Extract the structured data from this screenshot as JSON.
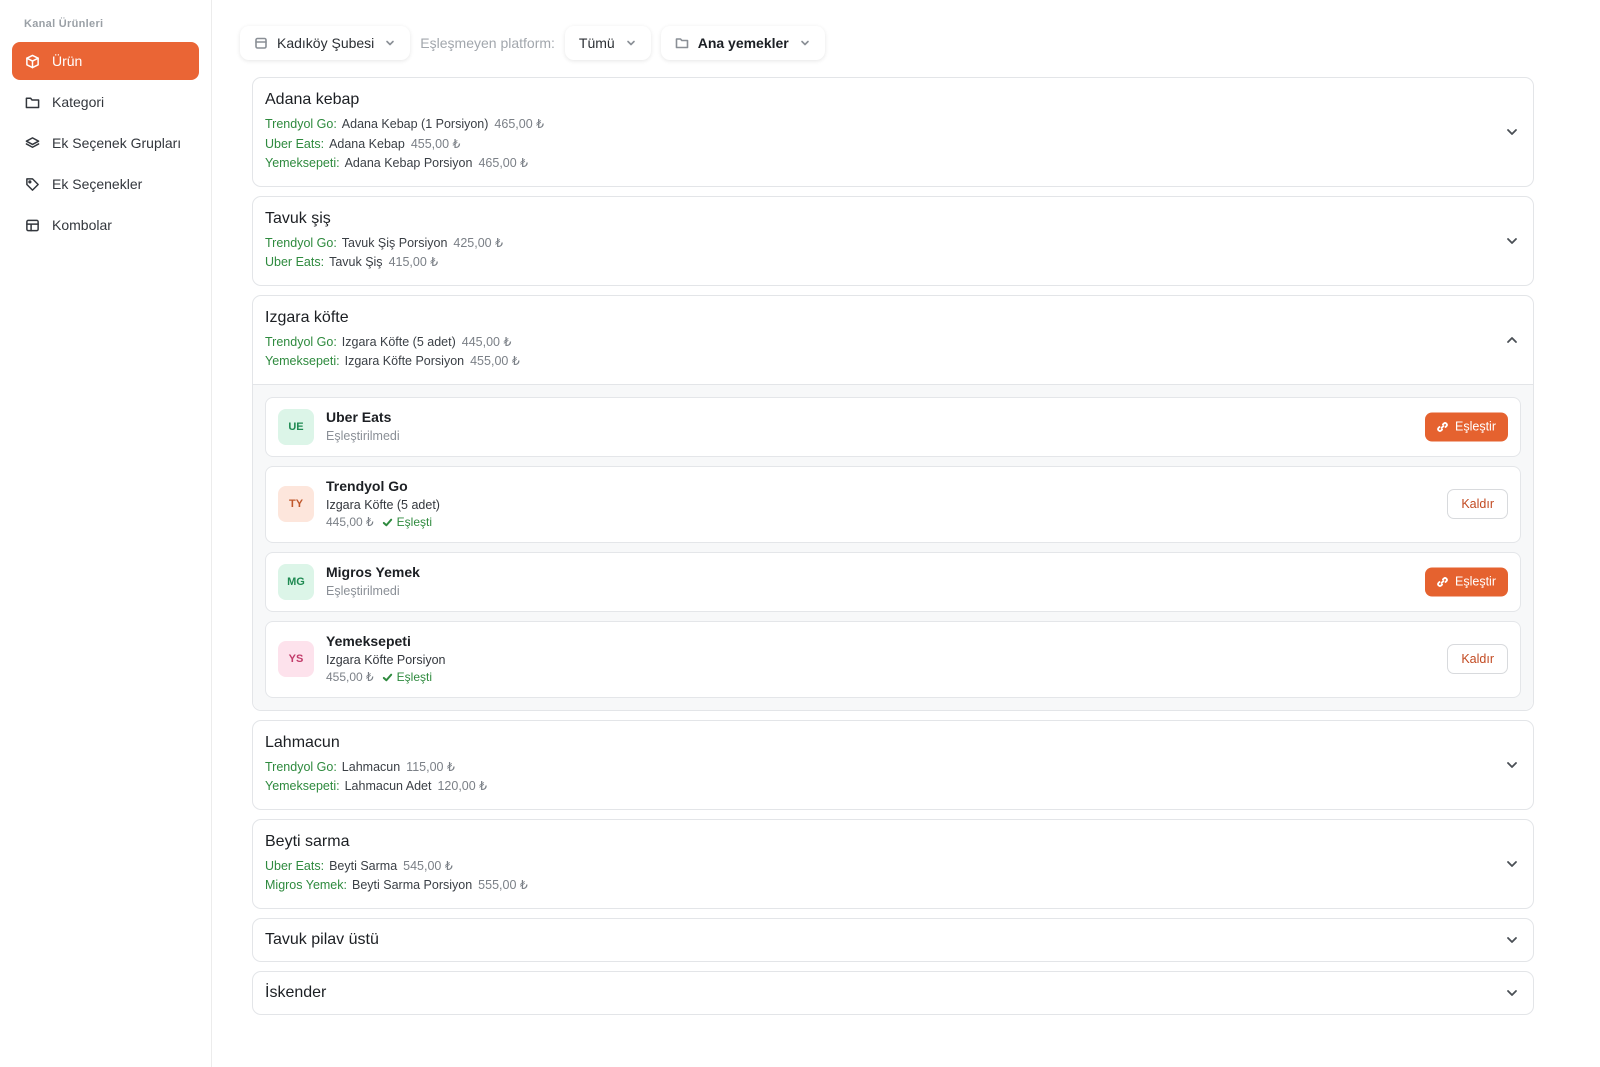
{
  "sidebar": {
    "heading": "Kanal Ürünleri",
    "items": [
      {
        "label": "Ürün",
        "icon": "box-icon",
        "active": true
      },
      {
        "label": "Kategori",
        "icon": "folder-icon"
      },
      {
        "label": "Ek Seçenek Grupları",
        "icon": "layers-icon"
      },
      {
        "label": "Ek Seçenekler",
        "icon": "tag-icon"
      },
      {
        "label": "Kombolar",
        "icon": "table-icon"
      }
    ]
  },
  "filters": {
    "branch": "Kadıköy Şubesi",
    "unmatched_label": "Eşleşmeyen platform:",
    "platform": "Tümü",
    "category": "Ana yemekler"
  },
  "products": [
    {
      "name": "Adana kebap",
      "channels": [
        {
          "platform": "Trendyol Go:",
          "product": "Adana Kebap (1 Porsiyon)",
          "price": "465,00 ₺"
        },
        {
          "platform": "Uber Eats:",
          "product": "Adana Kebap",
          "price": "455,00 ₺"
        },
        {
          "platform": "Yemeksepeti:",
          "product": "Adana Kebap Porsiyon",
          "price": "465,00 ₺"
        }
      ]
    },
    {
      "name": "Tavuk şiş",
      "channels": [
        {
          "platform": "Trendyol Go:",
          "product": "Tavuk Şiş Porsiyon",
          "price": "425,00 ₺"
        },
        {
          "platform": "Uber Eats:",
          "product": "Tavuk Şiş",
          "price": "415,00 ₺"
        }
      ]
    },
    {
      "name": "Izgara köfte",
      "channels": [
        {
          "platform": "Trendyol Go:",
          "product": "Izgara Köfte (5 adet)",
          "price": "445,00 ₺"
        },
        {
          "platform": "Yemeksepeti:",
          "product": "Izgara Köfte Porsiyon",
          "price": "455,00 ₺"
        }
      ],
      "platforms": [
        {
          "code": "UE",
          "name": "Uber Eats",
          "status": "Eşleştirilmedi",
          "action": "Eşleştir",
          "badge_bg": "#dcf5e8",
          "badge_fg": "#1f8a52"
        },
        {
          "code": "TY",
          "name": "Trendyol Go",
          "product": "Izgara Köfte (5 adet)",
          "price": "445,00 ₺",
          "matched": "Eşleşti",
          "action": "Kaldır",
          "badge_bg": "#fde6dc",
          "badge_fg": "#c0582c"
        },
        {
          "code": "MG",
          "name": "Migros Yemek",
          "status": "Eşleştirilmedi",
          "action": "Eşleştir",
          "badge_bg": "#dcf5e8",
          "badge_fg": "#1f8a52"
        },
        {
          "code": "YS",
          "name": "Yemeksepeti",
          "product": "Izgara Köfte Porsiyon",
          "price": "455,00 ₺",
          "matched": "Eşleşti",
          "action": "Kaldır",
          "badge_bg": "#fde2ec",
          "badge_fg": "#c23b6a"
        }
      ]
    },
    {
      "name": "Lahmacun",
      "channels": [
        {
          "platform": "Trendyol Go:",
          "product": "Lahmacun",
          "price": "115,00 ₺"
        },
        {
          "platform": "Yemeksepeti:",
          "product": "Lahmacun Adet",
          "price": "120,00 ₺"
        }
      ]
    },
    {
      "name": "Beyti sarma",
      "channels": [
        {
          "platform": "Uber Eats:",
          "product": "Beyti Sarma",
          "price": "545,00 ₺"
        },
        {
          "platform": "Migros Yemek:",
          "product": "Beyti Sarma Porsiyon",
          "price": "555,00 ₺"
        }
      ]
    },
    {
      "name": "Tavuk pilav üstü",
      "channels": []
    },
    {
      "name": "İskender",
      "channels": []
    }
  ],
  "colors": {
    "accent": "#ea6535",
    "channel_green": "#2e8a3e"
  }
}
